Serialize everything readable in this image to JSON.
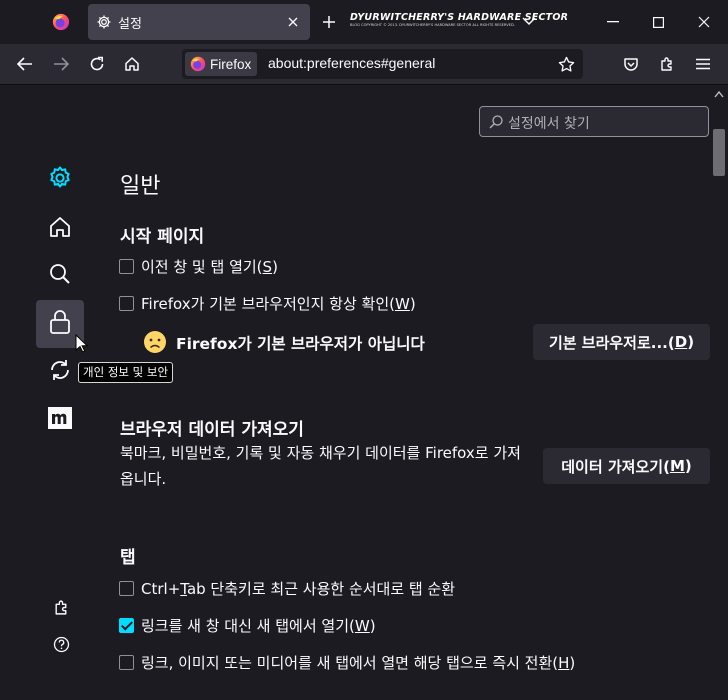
{
  "tabstrip": {
    "pinned_icon": "firefox-logo",
    "tab": {
      "icon": "gear-icon",
      "title": "설정"
    },
    "banner": {
      "title": "DYURWITCHERRY'S HARDWARE SECTOR",
      "subtitle": "BLOG COPYRIGHT © 2013. DYURWITCHERRY'S HARDWARE SECTOR ALL RIGHTS RESERVED."
    }
  },
  "navbar": {
    "identity_label": "Firefox",
    "url": "about:preferences#general"
  },
  "search": {
    "placeholder": "설정에서 찾기"
  },
  "sidebar": {
    "items": [
      {
        "icon": "gear-icon",
        "name": "general"
      },
      {
        "icon": "home-icon",
        "name": "home"
      },
      {
        "icon": "search-icon",
        "name": "search"
      },
      {
        "icon": "lock-icon",
        "name": "privacy"
      },
      {
        "icon": "sync-icon",
        "name": "sync"
      },
      {
        "icon": "mozilla-icon",
        "name": "more-from-mozilla"
      }
    ],
    "tooltip": "개인 정보 및 보안",
    "bottom": [
      {
        "icon": "puzzle-icon",
        "name": "extensions-themes"
      },
      {
        "icon": "help-icon",
        "name": "support"
      }
    ]
  },
  "main": {
    "title": "일반",
    "startup": {
      "heading": "시작 페이지",
      "restore_prefix": "이전 창 및 탭 열기(",
      "restore_key": "S",
      "restore_suffix": ")",
      "check_default_prefix": "Firefox가 기본 브라우저인지 항상 확인(",
      "check_default_key": "W",
      "check_default_suffix": ")",
      "not_default": "Firefox가 기본 브라우저가 아닙니다",
      "make_default_prefix": "기본 브라우저로...(",
      "make_default_key": "D",
      "make_default_suffix": ")"
    },
    "import": {
      "heading": "브라우저 데이터 가져오기",
      "desc_line1": "북마크, 비밀번호, 기록 및 자동 채우기 데이터를 Firefox로 가져",
      "desc_line2": "옵니다.",
      "button_prefix": "데이터 가져오기(",
      "button_key": "M",
      "button_suffix": ")"
    },
    "tabs": {
      "heading": "탭",
      "ctrl_tab_prefix": "Ctrl+",
      "ctrl_tab_key": "T",
      "ctrl_tab_suffix": "ab 단축키로 최근 사용한 순서대로 탭 순환",
      "ctrl_tab_checked": false,
      "open_links_prefix": "링크를 새 창 대신 새 탭에서 열기(",
      "open_links_key": "W",
      "open_links_suffix": ")",
      "open_links_checked": true,
      "switch_prefix": "링크, 이미지 또는 미디어를 새 탭에서 열면 해당 탭으로 즉시 전환(",
      "switch_key": "H",
      "switch_suffix": ")",
      "switch_checked": false
    }
  },
  "colors": {
    "accent": "#00ddff",
    "background": "#1c1b22",
    "toolbar": "#2b2a33",
    "button": "#2b2a33"
  }
}
